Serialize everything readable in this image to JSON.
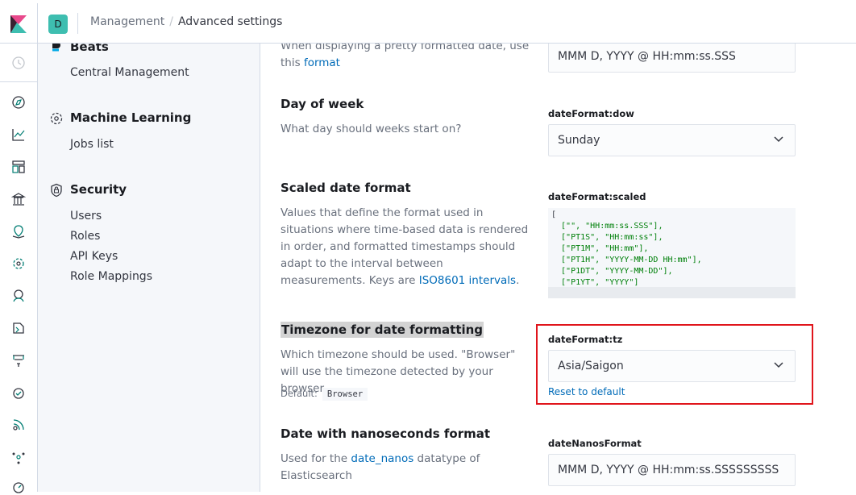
{
  "header": {
    "space_initial": "D",
    "breadcrumbs": [
      "Management",
      "Advanced settings"
    ],
    "breadcrumb_separator": "/"
  },
  "rail_icons": [
    "recent-icon",
    "discover-icon",
    "visualize-icon",
    "dashboard-icon",
    "canvas-icon",
    "maps-icon",
    "ml-icon",
    "metrics-icon",
    "logs-icon",
    "apm-icon",
    "uptime-icon",
    "siem-icon",
    "dev-tools-icon",
    "monitoring-icon"
  ],
  "sidenav": {
    "beats": {
      "title": "Beats",
      "items": [
        "Central Management"
      ]
    },
    "ml": {
      "title": "Machine Learning",
      "items": [
        "Jobs list"
      ]
    },
    "security": {
      "title": "Security",
      "items": [
        "Users",
        "Roles",
        "API Keys",
        "Role Mappings"
      ]
    }
  },
  "settings": {
    "pretty_date": {
      "desc_before": "When displaying a pretty formatted date, use this ",
      "desc_link": "format",
      "value": "MMM D, YYYY @ HH:mm:ss.SSS"
    },
    "dow": {
      "title": "Day of week",
      "desc": "What day should weeks start on?",
      "key": "dateFormat:dow",
      "value": "Sunday"
    },
    "scaled": {
      "title": "Scaled date format",
      "desc_before": "Values that define the format used in situations where time-based data is rendered in order, and formatted timestamps should adapt to the interval between measurements. Keys are ",
      "desc_link": "ISO8601 intervals",
      "desc_after": ".",
      "key": "dateFormat:scaled",
      "code_lines": [
        "[",
        "  [\"\", \"HH:mm:ss.SSS\"],",
        "  [\"PT1S\", \"HH:mm:ss\"],",
        "  [\"PT1M\", \"HH:mm\"],",
        "  [\"PT1H\", \"YYYY-MM-DD HH:mm\"],",
        "  [\"P1DT\", \"YYYY-MM-DD\"],",
        "  [\"P1YT\", \"YYYY\"]",
        "]"
      ]
    },
    "tz": {
      "title": "Timezone for date formatting",
      "desc": "Which timezone should be used. \"Browser\" will use the timezone detected by your browser.",
      "default_label": "Default:",
      "default_value": "Browser",
      "key": "dateFormat:tz",
      "value": "Asia/Saigon",
      "reset_label": "Reset to default"
    },
    "nanos": {
      "title": "Date with nanoseconds format",
      "desc_before": "Used for the ",
      "desc_link": "date_nanos",
      "desc_after": " datatype of Elasticsearch",
      "key": "dateNanosFormat",
      "value": "MMM D, YYYY @ HH:mm:ss.SSSSSSSSS"
    }
  },
  "colors": {
    "accent_link": "#006bb8",
    "highlight_border": "#e0151c",
    "space_badge": "#3ebeb0"
  }
}
